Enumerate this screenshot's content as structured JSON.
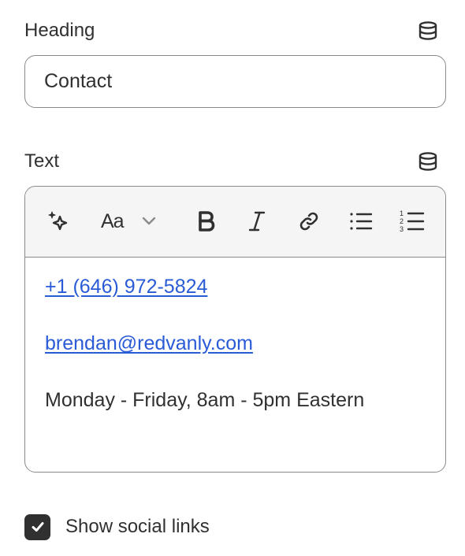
{
  "heading_field": {
    "label": "Heading",
    "value": "Contact",
    "dynamic_source_icon": "database-icon"
  },
  "text_field": {
    "label": "Text",
    "dynamic_source_icon": "database-icon",
    "toolbar": {
      "buttons": [
        {
          "name": "magic-sparkle",
          "icon": "sparkle-icon"
        },
        {
          "name": "text-format",
          "label": "Aa",
          "icon": "chevron-down-icon"
        },
        {
          "name": "bold",
          "icon": "bold-icon"
        },
        {
          "name": "italic",
          "icon": "italic-icon"
        },
        {
          "name": "link",
          "icon": "link-icon"
        },
        {
          "name": "bullet-list",
          "icon": "bullet-list-icon"
        },
        {
          "name": "numbered-list",
          "icon": "numbered-list-icon"
        }
      ],
      "font_label": "Aa"
    },
    "content": {
      "phone": "+1 (646) 972-5824",
      "email": "brendan@redvanly.com",
      "hours": "Monday - Friday, 8am - 5pm Eastern"
    }
  },
  "social_links": {
    "label": "Show social links",
    "checked": true
  },
  "colors": {
    "text": "#303030",
    "border": "#8a8a8a",
    "toolbar_bg": "#f5f5f5",
    "link": "#2a5bd7",
    "checkbox": "#303030"
  }
}
